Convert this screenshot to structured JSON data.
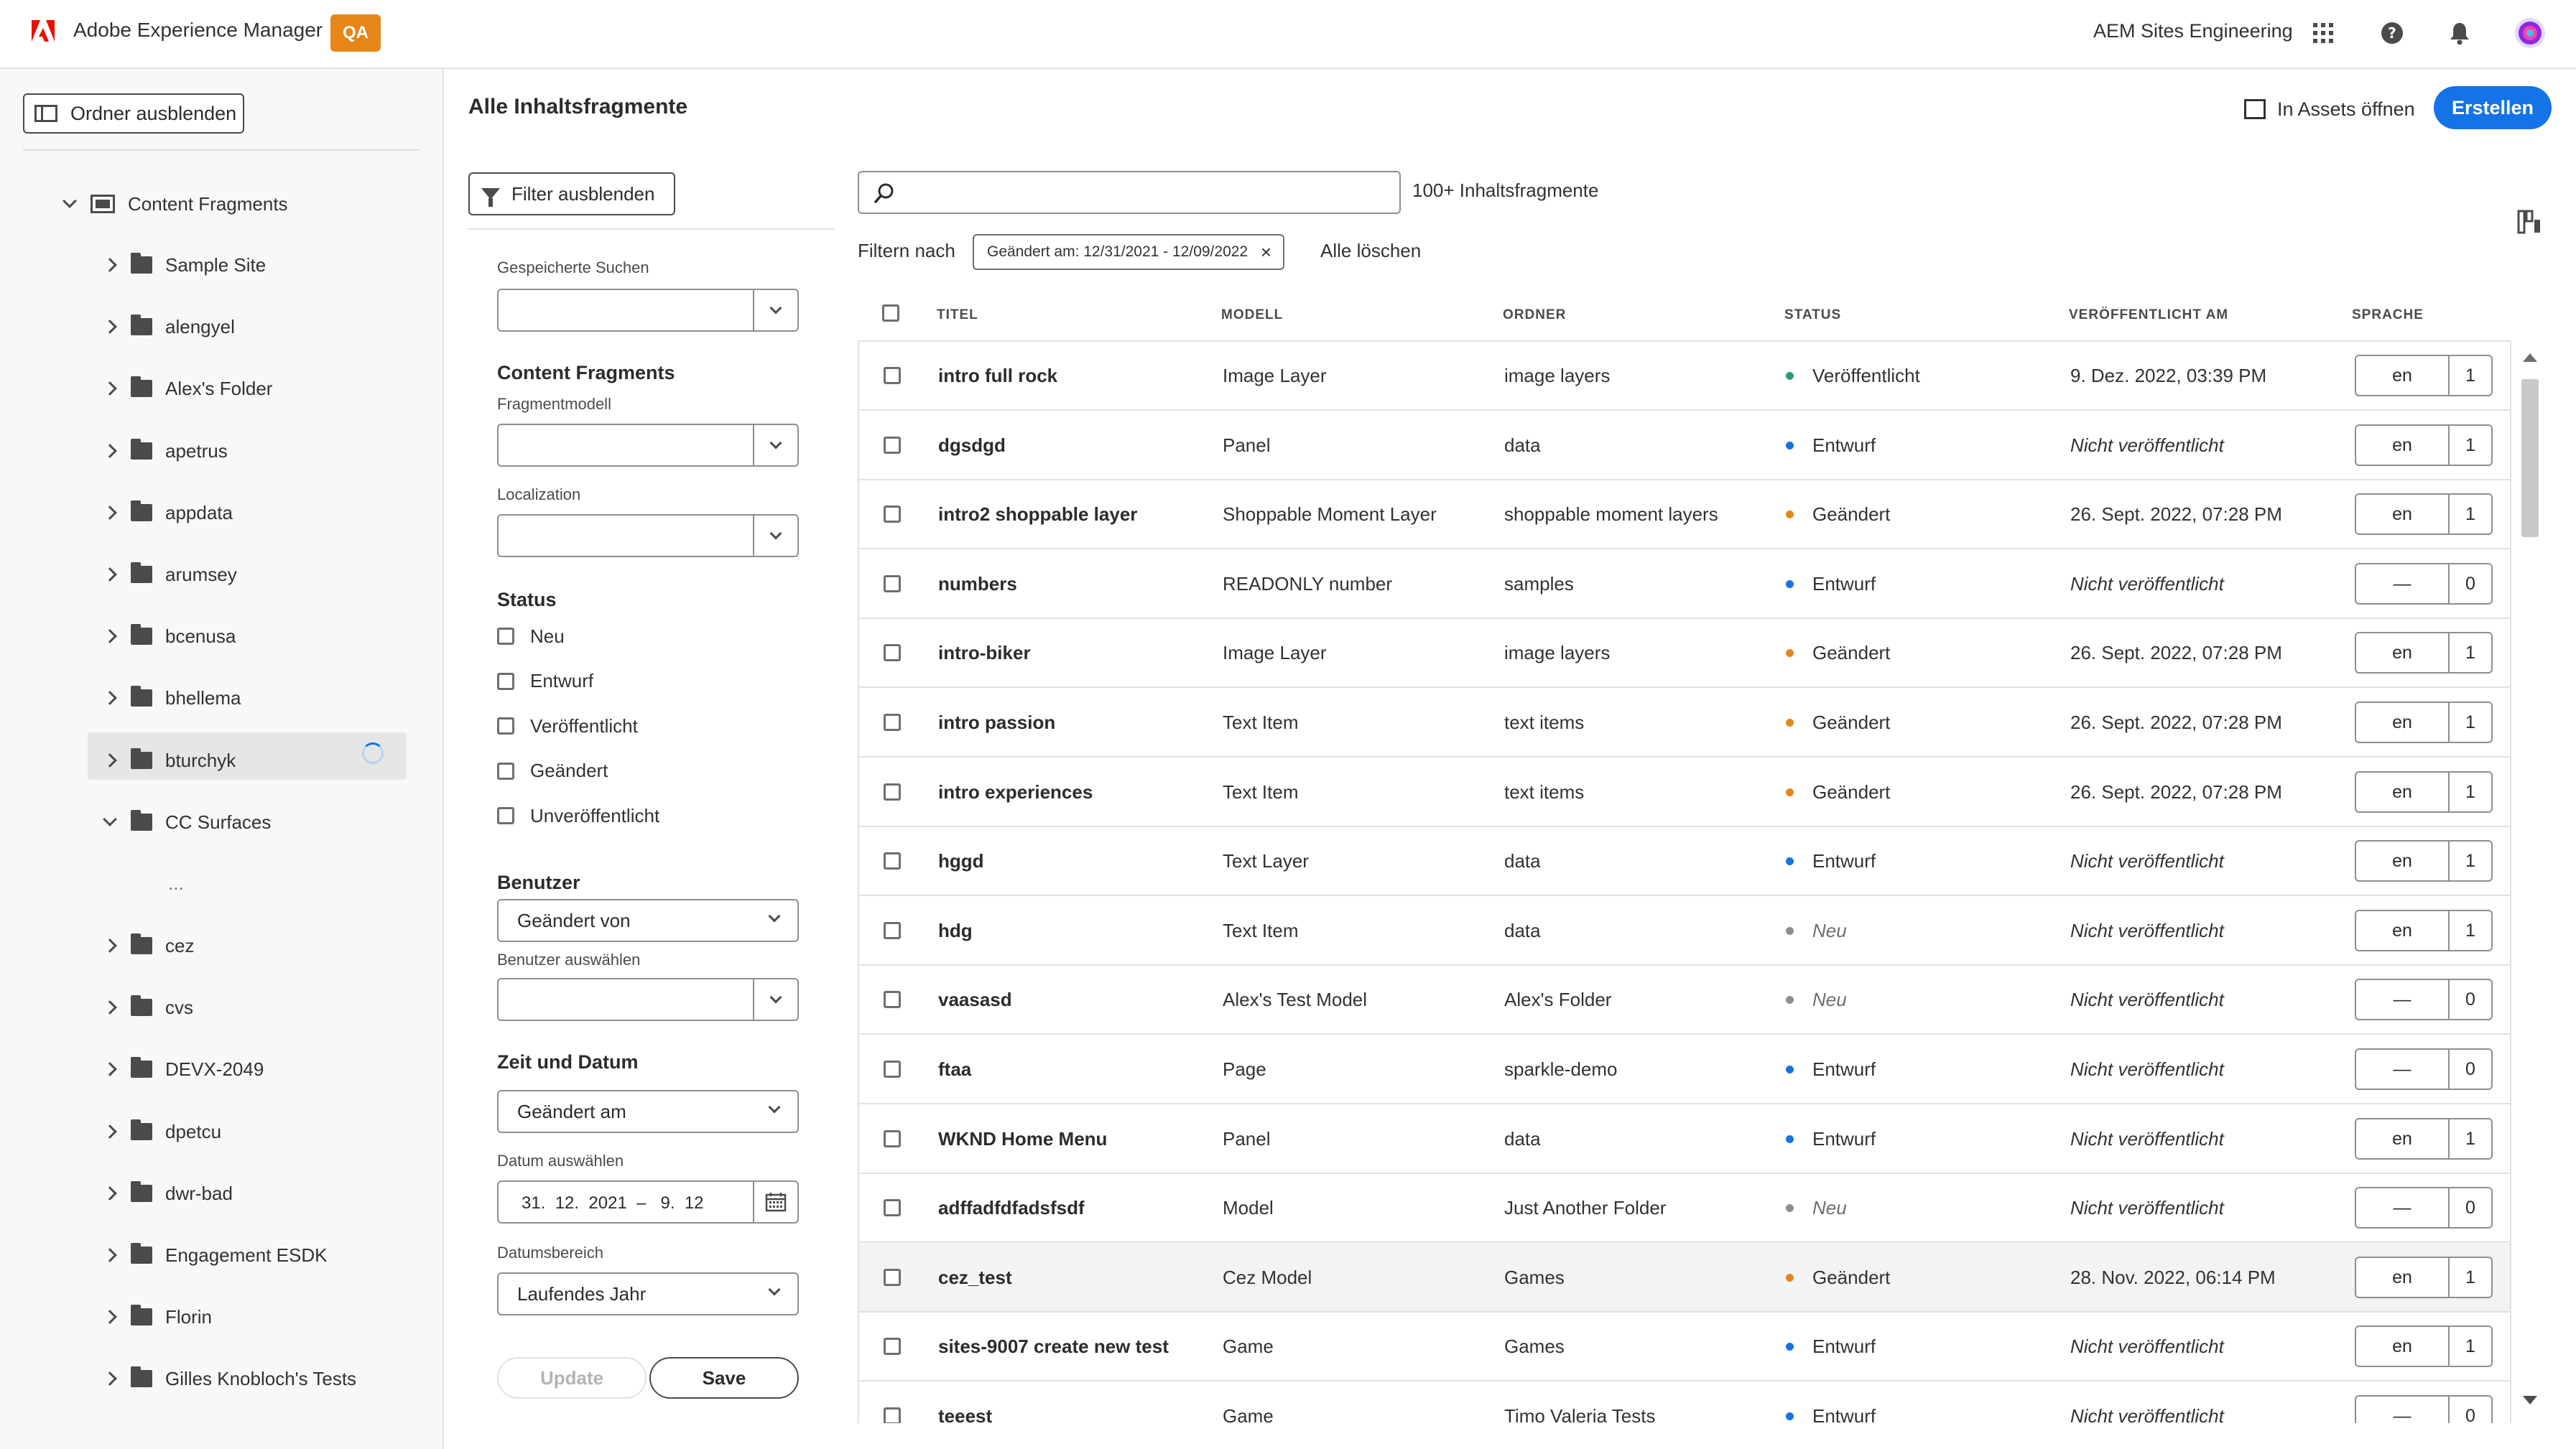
{
  "app": {
    "name": "Adobe Experience Manager",
    "env_badge": "QA",
    "org": "AEM Sites Engineering"
  },
  "icons": {
    "apps": "apps-grid-icon",
    "help": "help-icon",
    "bell": "bell-icon",
    "avatar": "avatar"
  },
  "leftrail": {
    "hide_folders_label": "Ordner ausblenden",
    "root_label": "Content Fragments",
    "items": [
      "Sample Site",
      "alengyel",
      "Alex's Folder",
      "apetrus",
      "appdata",
      "arumsey",
      "bcenusa",
      "bhellema",
      "bturchyk",
      "CC Surfaces",
      "cez",
      "cvs",
      "DEVX-2049",
      "dpetcu",
      "dwr-bad",
      "Engagement ESDK",
      "Florin",
      "Gilles Knobloch's Tests"
    ],
    "loading_ellipsis": "..."
  },
  "header": {
    "title": "Alle Inhaltsfragmente",
    "open_assets": "In Assets öffnen",
    "create": "Erstellen"
  },
  "filters": {
    "hide_filters": "Filter ausblenden",
    "saved_searches": "Gespeicherte Suchen",
    "cf_heading": "Content Fragments",
    "model_label": "Fragmentmodell",
    "localization_label": "Localization",
    "status_heading": "Status",
    "status_options": [
      "Neu",
      "Entwurf",
      "Veröffentlicht",
      "Geändert",
      "Unveröffentlicht"
    ],
    "user_heading": "Benutzer",
    "user_picker": "Geändert von",
    "user_select_label": "Benutzer auswählen",
    "time_heading": "Zeit und Datum",
    "time_picker": "Geändert am",
    "date_select_label": "Datum auswählen",
    "date_value": "31.  12.  2021  –   9.  12",
    "range_label": "Datumsbereich",
    "range_picker": "Laufendes Jahr",
    "update_btn": "Update",
    "save_btn": "Save"
  },
  "results": {
    "search_placeholder": "",
    "count": "100+ Inhaltsfragmente",
    "filter_by": "Filtern nach",
    "active_tag": "Geändert am: 12/31/2021 - 12/09/2022",
    "clear_all": "Alle löschen",
    "columns": [
      "TITEL",
      "MODELL",
      "ORDNER",
      "STATUS",
      "VERÖFFENTLICHT AM",
      "SPRACHE"
    ],
    "status_colors": {
      "Veröffentlicht": "#2d9d78",
      "Entwurf": "#1473e6",
      "Geändert": "#e68619",
      "Neu": "#8e8e8e"
    },
    "rows": [
      {
        "title": "intro full rock",
        "model": "Image Layer",
        "folder": "image layers",
        "status": "Veröffentlicht",
        "published": "9. Dez. 2022, 03:39 PM",
        "lang": "en",
        "versions": "1"
      },
      {
        "title": "dgsdgd",
        "model": "Panel",
        "folder": "data",
        "status": "Entwurf",
        "published": "Nicht veröffentlicht",
        "lang": "en",
        "versions": "1"
      },
      {
        "title": "intro2 shoppable layer",
        "model": "Shoppable Moment Layer",
        "folder": "shoppable moment layers",
        "status": "Geändert",
        "published": "26. Sept. 2022, 07:28 PM",
        "lang": "en",
        "versions": "1"
      },
      {
        "title": "numbers",
        "model": "READONLY number",
        "folder": "samples",
        "status": "Entwurf",
        "published": "Nicht veröffentlicht",
        "lang": "—",
        "versions": "0"
      },
      {
        "title": "intro-biker",
        "model": "Image Layer",
        "folder": "image layers",
        "status": "Geändert",
        "published": "26. Sept. 2022, 07:28 PM",
        "lang": "en",
        "versions": "1"
      },
      {
        "title": "intro passion",
        "model": "Text Item",
        "folder": "text items",
        "status": "Geändert",
        "published": "26. Sept. 2022, 07:28 PM",
        "lang": "en",
        "versions": "1"
      },
      {
        "title": "intro experiences",
        "model": "Text Item",
        "folder": "text items",
        "status": "Geändert",
        "published": "26. Sept. 2022, 07:28 PM",
        "lang": "en",
        "versions": "1"
      },
      {
        "title": "hggd",
        "model": "Text Layer",
        "folder": "data",
        "status": "Entwurf",
        "published": "Nicht veröffentlicht",
        "lang": "en",
        "versions": "1"
      },
      {
        "title": "hdg",
        "model": "Text Item",
        "folder": "data",
        "status": "Neu",
        "published": "Nicht veröffentlicht",
        "lang": "en",
        "versions": "1"
      },
      {
        "title": "vaasasd",
        "model": "Alex's Test Model",
        "folder": "Alex's Folder",
        "status": "Neu",
        "published": "Nicht veröffentlicht",
        "lang": "—",
        "versions": "0"
      },
      {
        "title": "ftaa",
        "model": "Page",
        "folder": "sparkle-demo",
        "status": "Entwurf",
        "published": "Nicht veröffentlicht",
        "lang": "—",
        "versions": "0"
      },
      {
        "title": "WKND Home Menu",
        "model": "Panel",
        "folder": "data",
        "status": "Entwurf",
        "published": "Nicht veröffentlicht",
        "lang": "en",
        "versions": "1"
      },
      {
        "title": "adffadfdfadsfsdf",
        "model": "Model",
        "folder": "Just Another Folder",
        "status": "Neu",
        "published": "Nicht veröffentlicht",
        "lang": "—",
        "versions": "0"
      },
      {
        "title": "cez_test",
        "model": "Cez Model",
        "folder": "Games",
        "status": "Geändert",
        "published": "28. Nov. 2022, 06:14 PM",
        "lang": "en",
        "versions": "1"
      },
      {
        "title": "sites-9007 create new test",
        "model": "Game",
        "folder": "Games",
        "status": "Entwurf",
        "published": "Nicht veröffentlicht",
        "lang": "en",
        "versions": "1"
      },
      {
        "title": "teeest",
        "model": "Game",
        "folder": "Timo Valeria Tests",
        "status": "Entwurf",
        "published": "Nicht veröffentlicht",
        "lang": "—",
        "versions": "0"
      }
    ]
  }
}
